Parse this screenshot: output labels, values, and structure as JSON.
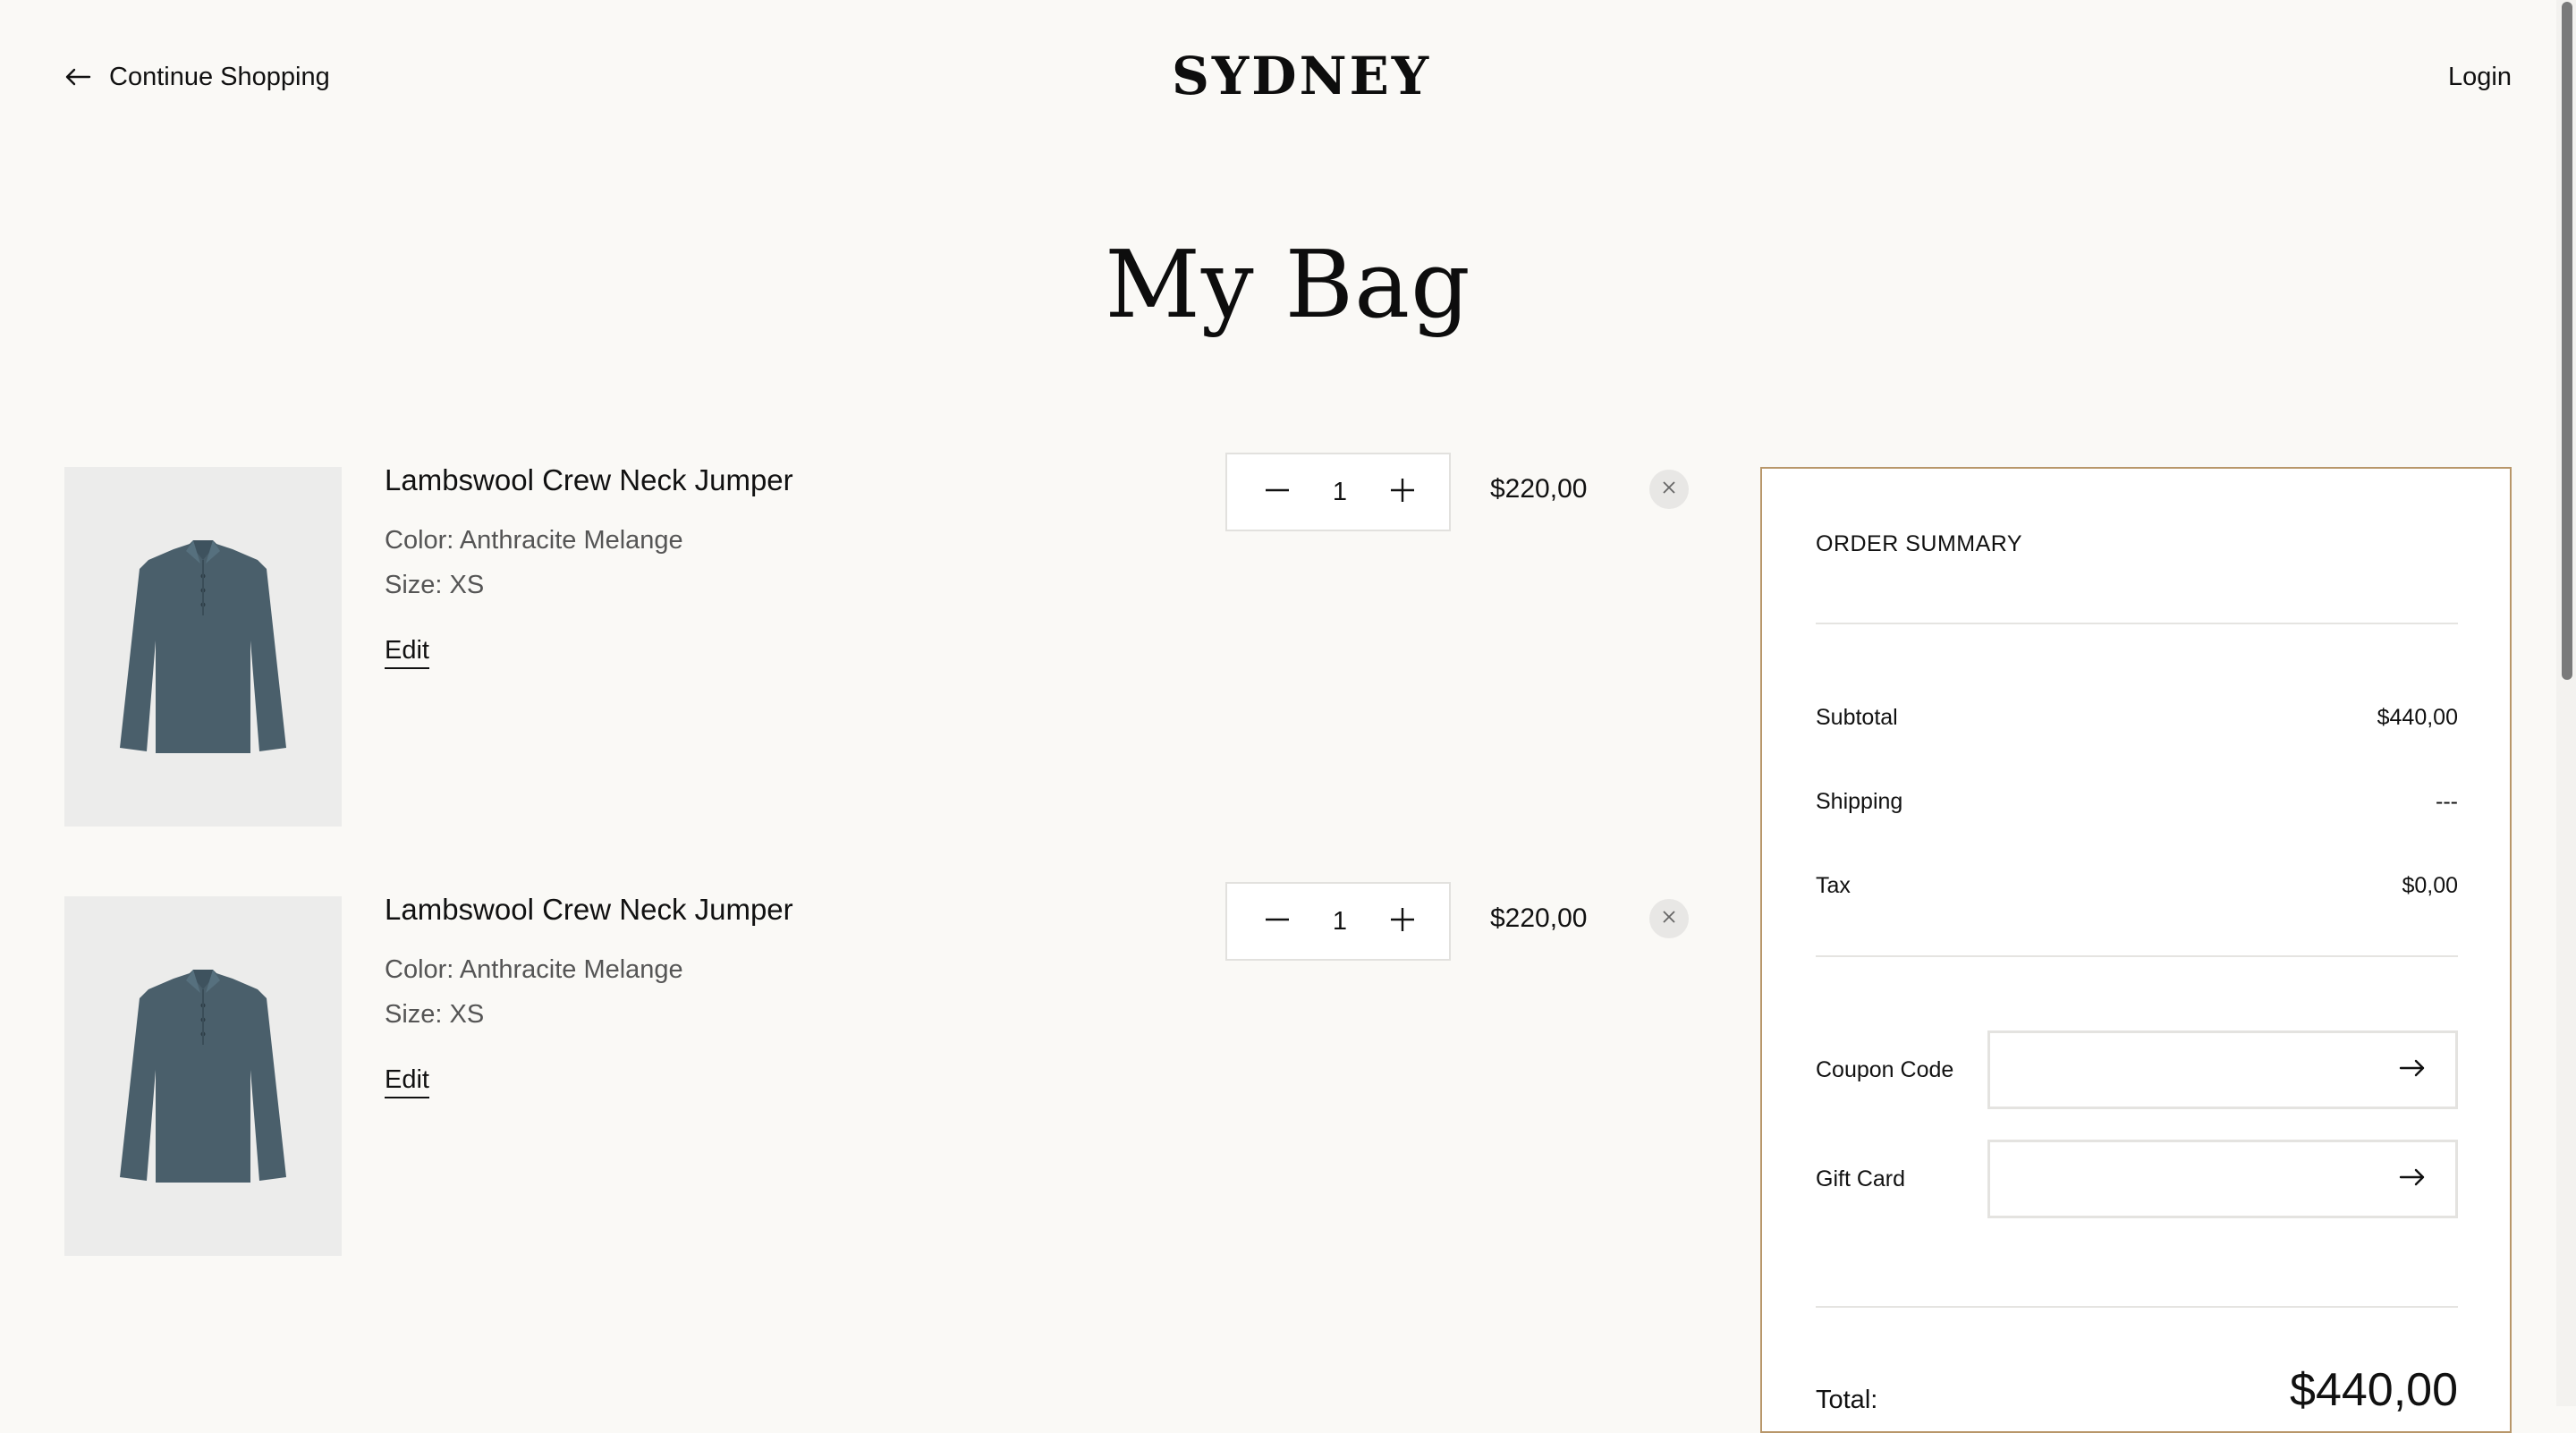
{
  "header": {
    "back_label": "Continue Shopping",
    "logo": "SYDNEY",
    "login_label": "Login"
  },
  "page": {
    "title": "My Bag"
  },
  "cart": {
    "items": [
      {
        "name": "Lambswool Crew Neck Jumper",
        "color": "Color: Anthracite Melange",
        "size": "Size: XS",
        "edit_label": "Edit",
        "quantity": "1",
        "price": "$220,00",
        "image_icon": "shirt-image"
      },
      {
        "name": "Lambswool Crew Neck Jumper",
        "color": "Color: Anthracite Melange",
        "size": "Size: XS",
        "edit_label": "Edit",
        "quantity": "1",
        "price": "$220,00",
        "image_icon": "shirt-image"
      }
    ]
  },
  "summary": {
    "title": "ORDER SUMMARY",
    "subtotal_label": "Subtotal",
    "subtotal_value": "$440,00",
    "shipping_label": "Shipping",
    "shipping_value": "---",
    "tax_label": "Tax",
    "tax_value": "$0,00",
    "coupon_label": "Coupon Code",
    "coupon_value": "",
    "gift_label": "Gift Card",
    "gift_value": "",
    "total_label": "Total:",
    "total_value": "$440,00"
  },
  "colors": {
    "background": "#faf9f6",
    "summary_border": "#b8976a",
    "product_image_bg": "#ececeb",
    "garment": "#4a5f6b"
  }
}
